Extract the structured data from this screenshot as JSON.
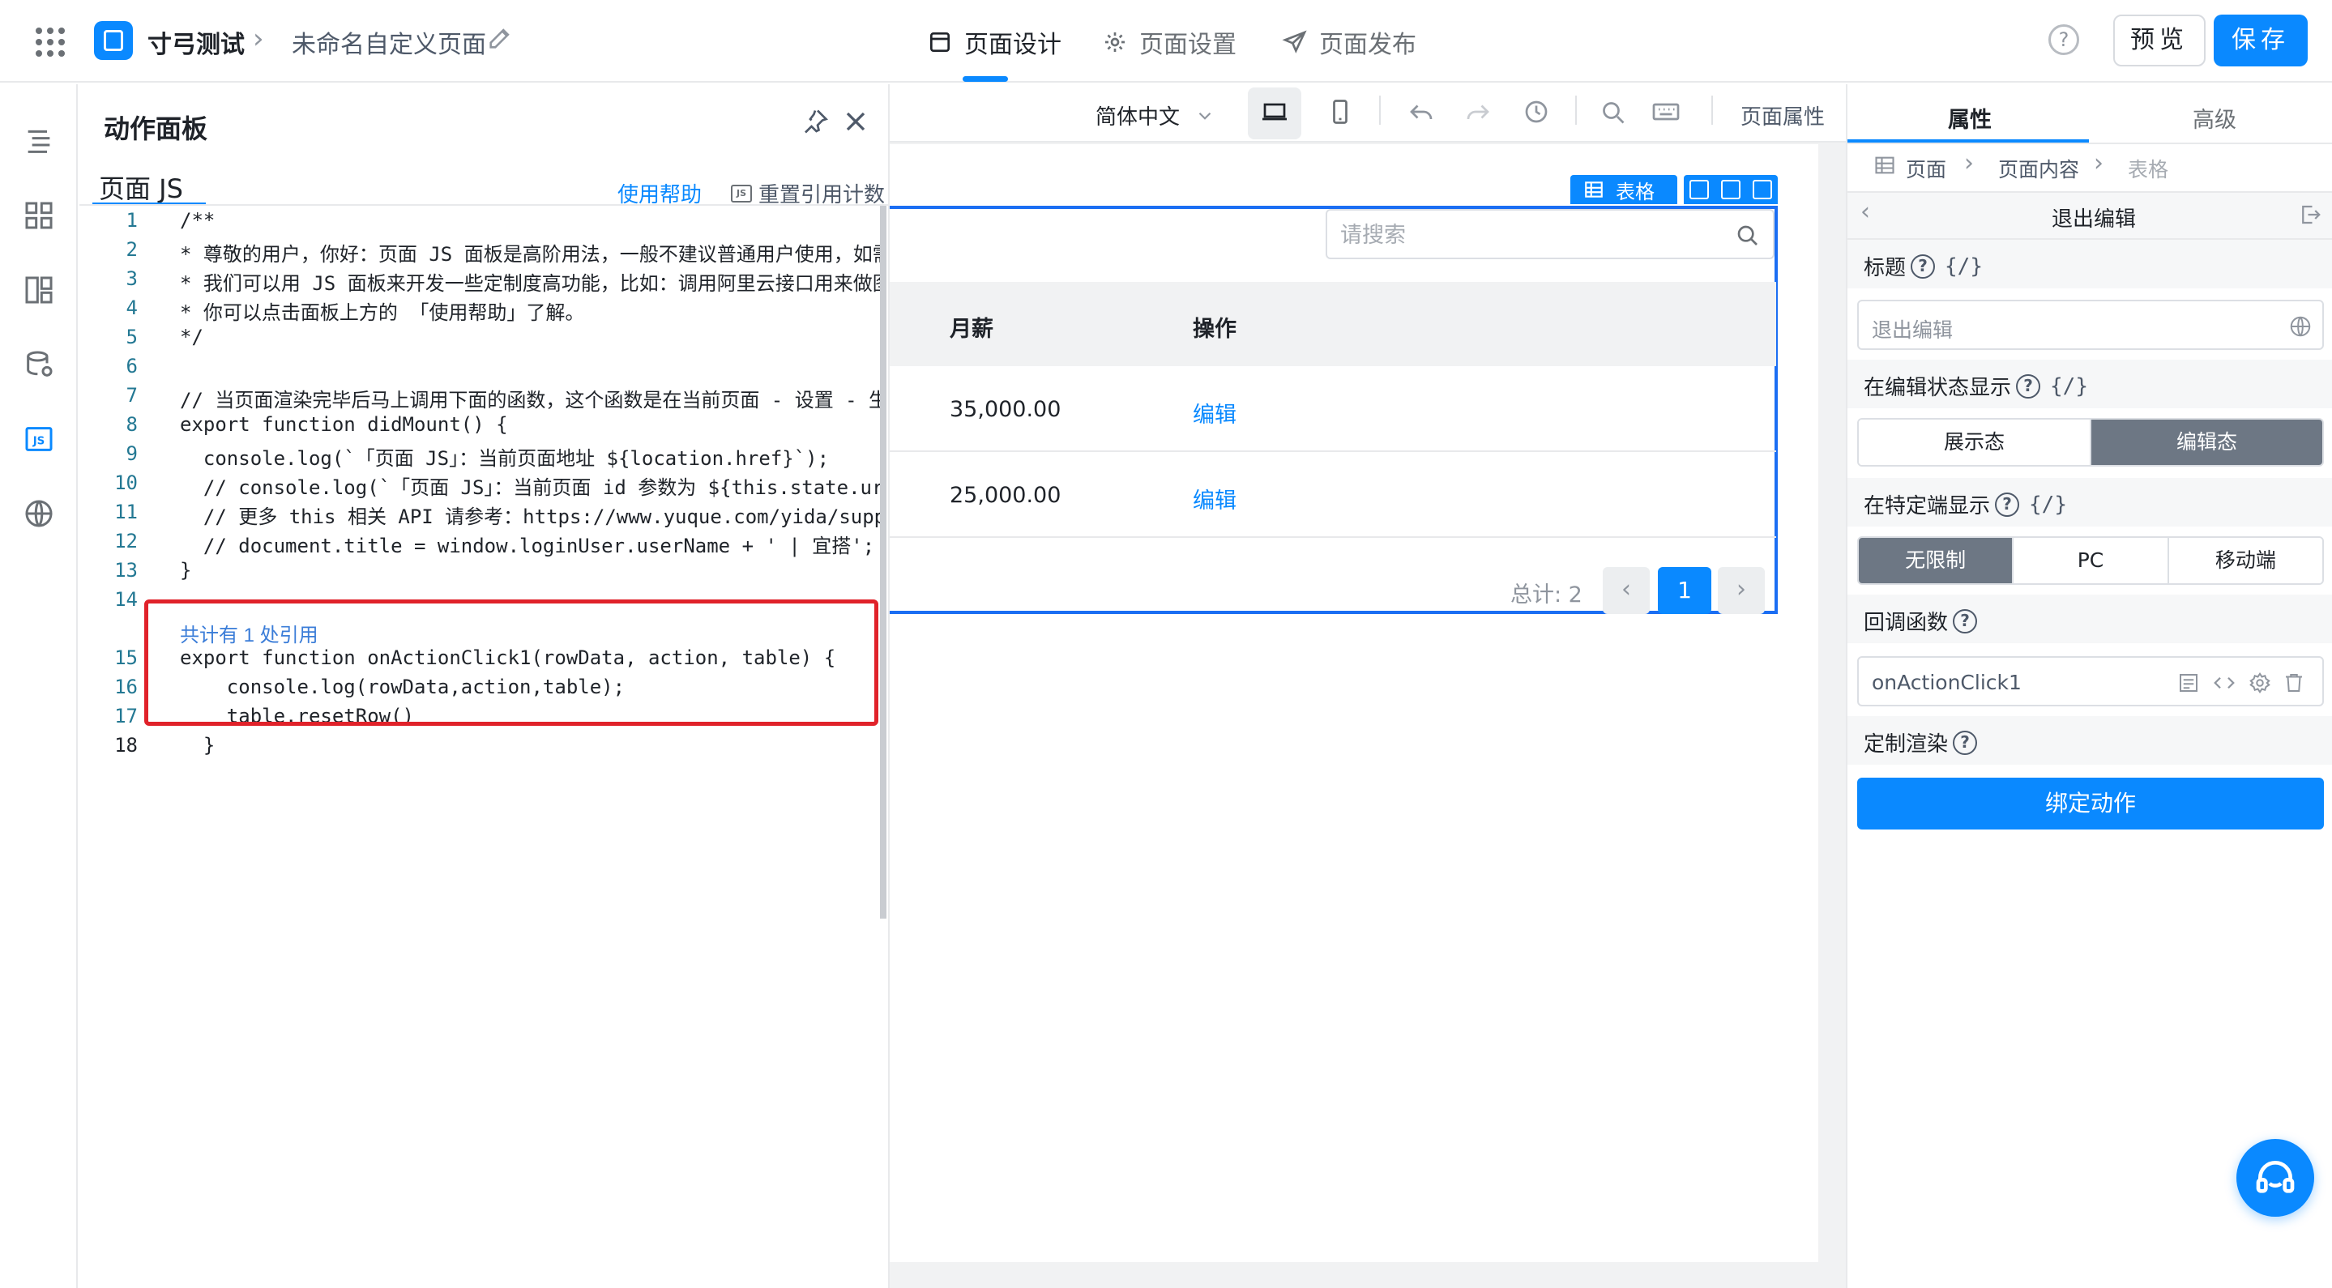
{
  "header": {
    "app_name": "寸弓测试",
    "page_name": "未命名自定义页面",
    "tabs": [
      {
        "label": "页面设计",
        "icon": "layout-icon",
        "active": true
      },
      {
        "label": "页面设置",
        "icon": "gear-icon",
        "active": false
      },
      {
        "label": "页面发布",
        "icon": "send-icon",
        "active": false
      }
    ],
    "preview_label": "预览",
    "save_label": "保存",
    "accent": "#0a89ff"
  },
  "rail": {
    "items": [
      "outline-icon",
      "components-icon",
      "templates-icon",
      "datasource-icon",
      "js-icon",
      "globe-icon"
    ]
  },
  "action_panel": {
    "title": "动作面板",
    "tab_label": "页面 JS",
    "use_help": "使用帮助",
    "reset_count": "重置引用计数",
    "js_badge": "JS",
    "ref_hint": "共计有 1 处引用",
    "code_lines": [
      {
        "n": "1",
        "text": "/**"
      },
      {
        "n": "2",
        "text": "* 尊敬的用户，你好：页面 JS 面板是高阶用法，一般不建议普通用户使用，如需"
      },
      {
        "n": "3",
        "text": "* 我们可以用 JS 面板来开发一些定制度高功能，比如：调用阿里云接口用来做图"
      },
      {
        "n": "4",
        "text": "* 你可以点击面板上方的 「使用帮助」了解。"
      },
      {
        "n": "5",
        "text": "*/"
      },
      {
        "n": "6",
        "text": ""
      },
      {
        "n": "7",
        "text": "// 当页面渲染完毕后马上调用下面的函数，这个函数是在当前页面 - 设置 - 生"
      },
      {
        "n": "8",
        "text": "export function didMount() {"
      },
      {
        "n": "9",
        "text": "  console.log(`「页面 JS」：当前页面地址 ${location.href}`);"
      },
      {
        "n": "10",
        "text": "  // console.log(`「页面 JS」：当前页面 id 参数为 ${this.state.ur"
      },
      {
        "n": "11",
        "text": "  // 更多 this 相关 API 请参考：https://www.yuque.com/yida/supp"
      },
      {
        "n": "12",
        "text": "  // document.title = window.loginUser.userName + ' | 宜搭';"
      },
      {
        "n": "13",
        "text": "}"
      },
      {
        "n": "14",
        "text": ""
      },
      {
        "n": "15",
        "text": "export function onActionClick1(rowData, action, table) {"
      },
      {
        "n": "16",
        "text": "    console.log(rowData,action,table);"
      },
      {
        "n": "17",
        "text": "    table.resetRow()"
      },
      {
        "n": "18",
        "text": "  }"
      }
    ]
  },
  "canvas_toolbar": {
    "language": "简体中文",
    "page_props": "页面属性"
  },
  "table": {
    "tag_label": "表格",
    "search_placeholder": "请搜索",
    "columns": [
      "月薪",
      "操作"
    ],
    "rows": [
      {
        "salary": "35,000.00",
        "action": "编辑"
      },
      {
        "salary": "25,000.00",
        "action": "编辑"
      }
    ],
    "total": "总计: 2",
    "current_page": "1"
  },
  "props": {
    "tabs": [
      "属性",
      "高级"
    ],
    "breadcrumb": [
      "页面",
      "页面内容",
      "表格"
    ],
    "section_title": "退出编辑",
    "title_label": "标题",
    "title_value": "退出编辑",
    "edit_show_label": "在编辑状态显示",
    "edit_modes": [
      "展示态",
      "编辑态"
    ],
    "terminal_label": "在特定端显示",
    "terminals": [
      "无限制",
      "PC",
      "移动端"
    ],
    "callback_label": "回调函数",
    "callback_value": "onActionClick1",
    "render_label": "定制渲染",
    "bind_action": "绑定动作",
    "brace": "{/}"
  }
}
